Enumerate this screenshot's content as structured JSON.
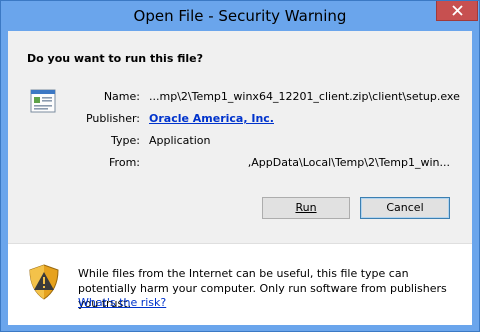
{
  "window": {
    "title": "Open File - Security Warning"
  },
  "dialog": {
    "question": "Do you want to run this file?",
    "fields": {
      "name_label": "Name:",
      "name_value": "...mp\\2\\Temp1_winx64_12201_client.zip\\client\\setup.exe",
      "publisher_label": "Publisher:",
      "publisher_value": "Oracle America, Inc.",
      "type_label": "Type:",
      "type_value": "Application",
      "from_label": "From:",
      "from_value": ",AppData\\Local\\Temp\\2\\Temp1_win..."
    },
    "buttons": {
      "run": "Run",
      "cancel": "Cancel"
    }
  },
  "warning": {
    "text": "While files from the Internet can be useful, this file type can potentially harm your computer. Only run software from publishers you trust.",
    "link": "What's the risk?"
  },
  "icons": {
    "close": "close-icon",
    "file": "executable-file-icon",
    "shield": "security-shield-icon"
  },
  "colors": {
    "titlebar": "#6aa5ec",
    "close_button": "#c75050",
    "link": "#0033cc"
  }
}
